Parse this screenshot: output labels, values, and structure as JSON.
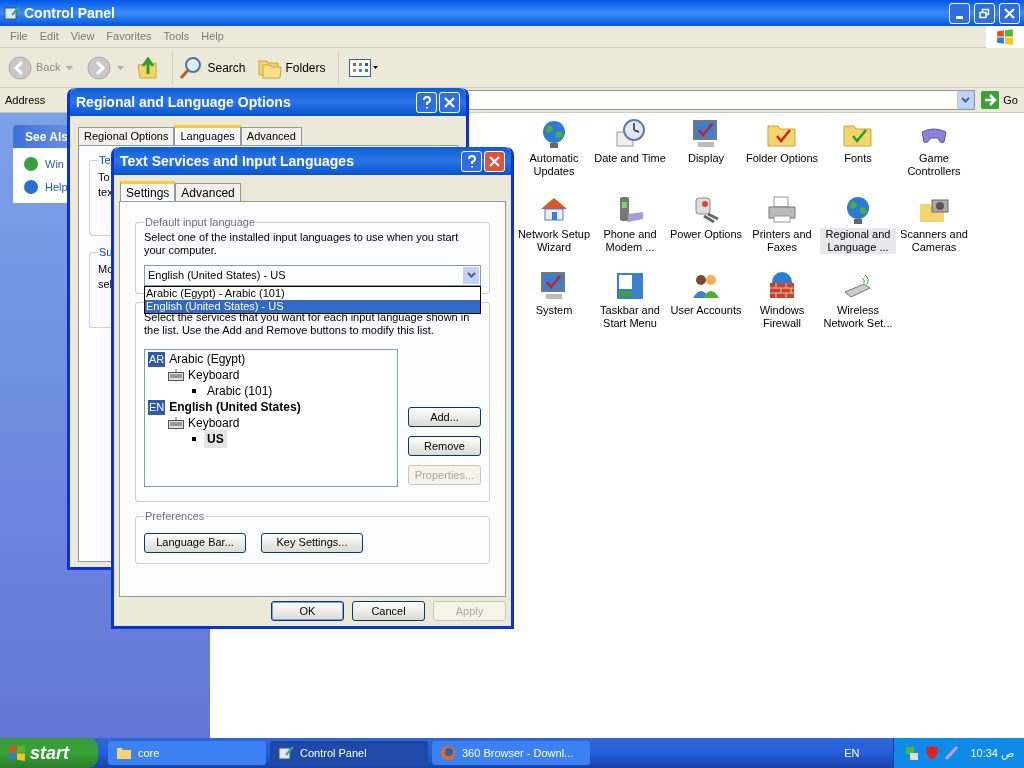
{
  "main_window": {
    "title": "Control Panel",
    "menu": [
      "File",
      "Edit",
      "View",
      "Favorites",
      "Tools",
      "Help"
    ],
    "toolbar": {
      "back": "Back",
      "search": "Search",
      "folders": "Folders"
    },
    "address": {
      "label": "Address",
      "go": "Go"
    },
    "see_also": {
      "title": "See Als",
      "links": [
        "Win",
        "Help"
      ]
    },
    "applets": [
      {
        "label": "Automatic Updates",
        "selected": false
      },
      {
        "label": "Date and Time",
        "selected": false
      },
      {
        "label": "Display",
        "selected": false
      },
      {
        "label": "Folder Options",
        "selected": false
      },
      {
        "label": "Fonts",
        "selected": false
      },
      {
        "label": "Game Controllers",
        "selected": false
      },
      {
        "label": "Network Setup Wizard",
        "selected": false
      },
      {
        "label": "Phone and Modem ...",
        "selected": false
      },
      {
        "label": "Power Options",
        "selected": false
      },
      {
        "label": "Printers and Faxes",
        "selected": false
      },
      {
        "label": "Regional and Language ...",
        "selected": true
      },
      {
        "label": "Scanners and Cameras",
        "selected": false
      },
      {
        "label": "System",
        "selected": false
      },
      {
        "label": "Taskbar and Start Menu",
        "selected": false
      },
      {
        "label": "User Accounts",
        "selected": false
      },
      {
        "label": "Windows Firewall",
        "selected": false
      },
      {
        "label": "Wireless Network Set...",
        "selected": false
      }
    ]
  },
  "regional_dialog": {
    "title": "Regional and Language Options",
    "tabs": [
      {
        "label": "Regional Options",
        "selected": false
      },
      {
        "label": "Languages",
        "selected": true
      },
      {
        "label": "Advanced",
        "selected": false
      }
    ],
    "groups": [
      {
        "label": "Te",
        "lines": [
          "To",
          "tex"
        ]
      },
      {
        "label": "Su",
        "lines": [
          "Mo",
          "sel"
        ]
      }
    ]
  },
  "text_services_dialog": {
    "title": "Text Services and Input Languages",
    "tabs": [
      {
        "label": "Settings",
        "selected": true
      },
      {
        "label": "Advanced",
        "selected": false
      }
    ],
    "default_language": {
      "label": "Default input language",
      "description": "Select one of the installed input languages to use when you start your computer.",
      "value": "English (United States) - US",
      "options": [
        {
          "label": "Arabic (Egypt) - Arabic (101)",
          "selected": false
        },
        {
          "label": "English (United States) - US",
          "selected": true
        }
      ]
    },
    "installed_services": {
      "description": "Select the services that you want for each input language shown in the list. Use the Add and Remove buttons to modify this list.",
      "tree": [
        {
          "kind": "language",
          "badge": "AR",
          "label": "Arabic (Egypt)",
          "default": false,
          "children": [
            {
              "kind": "service",
              "label": "Keyboard",
              "children": [
                {
                  "kind": "layout",
                  "label": "Arabic (101)",
                  "default": false,
                  "selected": false
                }
              ]
            }
          ]
        },
        {
          "kind": "language",
          "badge": "EN",
          "label": "English (United States)",
          "default": true,
          "children": [
            {
              "kind": "service",
              "label": "Keyboard",
              "children": [
                {
                  "kind": "layout",
                  "label": "US",
                  "default": true,
                  "selected": true
                }
              ]
            }
          ]
        }
      ],
      "buttons": [
        {
          "label": "Add...",
          "disabled": false
        },
        {
          "label": "Remove",
          "disabled": false
        },
        {
          "label": "Properties...",
          "disabled": true
        }
      ]
    },
    "preferences": {
      "label": "Preferences",
      "buttons": [
        "Language Bar...",
        "Key Settings..."
      ]
    },
    "buttons": [
      {
        "label": "OK",
        "disabled": false,
        "default": true
      },
      {
        "label": "Cancel",
        "disabled": false,
        "default": false
      },
      {
        "label": "Apply",
        "disabled": true,
        "default": false
      }
    ]
  },
  "taskbar": {
    "start": "start",
    "tasks": [
      {
        "label": "core",
        "selected": false,
        "kind": "folder"
      },
      {
        "label": "Control Panel",
        "selected": true,
        "kind": "control"
      },
      {
        "label": "360 Browser - Downl...",
        "selected": false,
        "kind": "browser"
      }
    ],
    "language": "EN",
    "clock": "10:34 ص"
  }
}
